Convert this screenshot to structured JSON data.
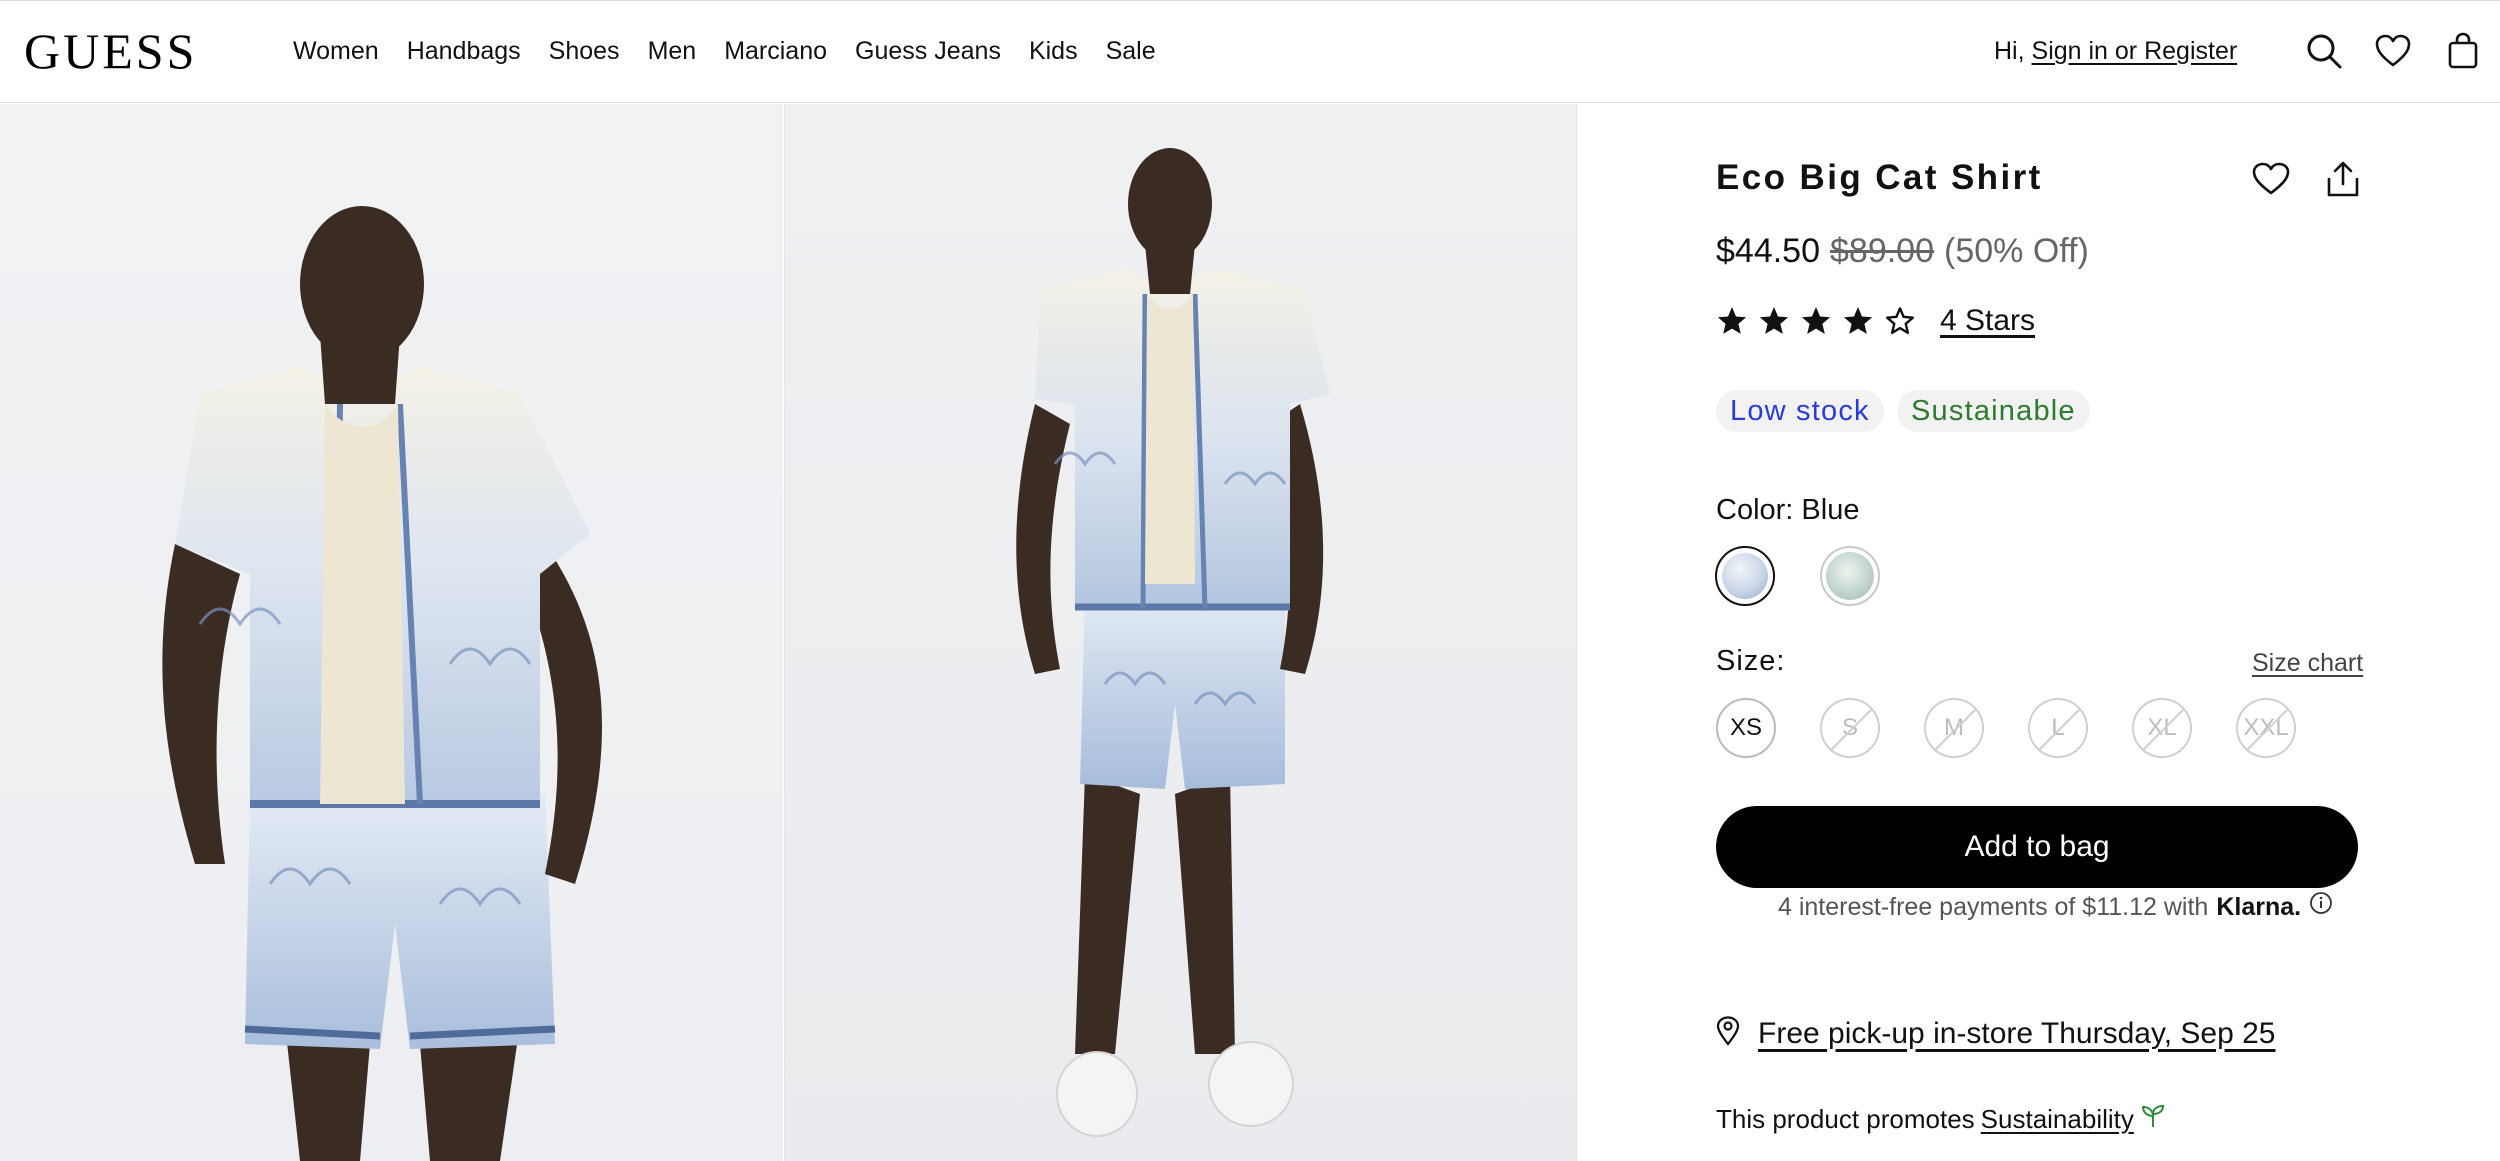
{
  "header": {
    "logo": "GUESS",
    "nav": [
      "Women",
      "Handbags",
      "Shoes",
      "Men",
      "Marciano",
      "Guess Jeans",
      "Kids",
      "Sale"
    ],
    "greeting_prefix": "Hi,",
    "signin_link": "Sign in or Register",
    "icons": [
      "search-icon",
      "heart-icon",
      "bag-icon"
    ]
  },
  "gallery": {
    "images": [
      "front-view-photo",
      "full-length-photo"
    ]
  },
  "product": {
    "title": "Eco Big Cat Shirt",
    "price_now": "$44.50",
    "price_was": "$89.00",
    "discount": "(50% Off)",
    "rating": 4,
    "rating_max": 5,
    "rating_label": "4 Stars",
    "badges": {
      "stock": "Low stock",
      "sustainable": "Sustainable"
    },
    "color_label": "Color: Blue",
    "colors": [
      "blue-print",
      "green-print"
    ],
    "size_label": "Size:",
    "size_chart_link": "Size chart",
    "sizes": [
      {
        "label": "XS",
        "available": true
      },
      {
        "label": "S",
        "available": false
      },
      {
        "label": "M",
        "available": false
      },
      {
        "label": "L",
        "available": false
      },
      {
        "label": "XL",
        "available": false
      },
      {
        "label": "XXL",
        "available": false
      }
    ],
    "add_button": "Add to bag",
    "klarna_text": "4 interest-free payments of $11.12 with",
    "klarna_brand": "Klarna.",
    "pickup_text": "Free pick-up in-store Thursday, Sep 25",
    "promote_text": "This product promotes",
    "promote_link": "Sustainability"
  },
  "colors": {
    "accent": "#000000",
    "low_stock": "#2b3bd6",
    "sustainable": "#2e7a2e",
    "badge_bg": "#f2f2f2"
  }
}
